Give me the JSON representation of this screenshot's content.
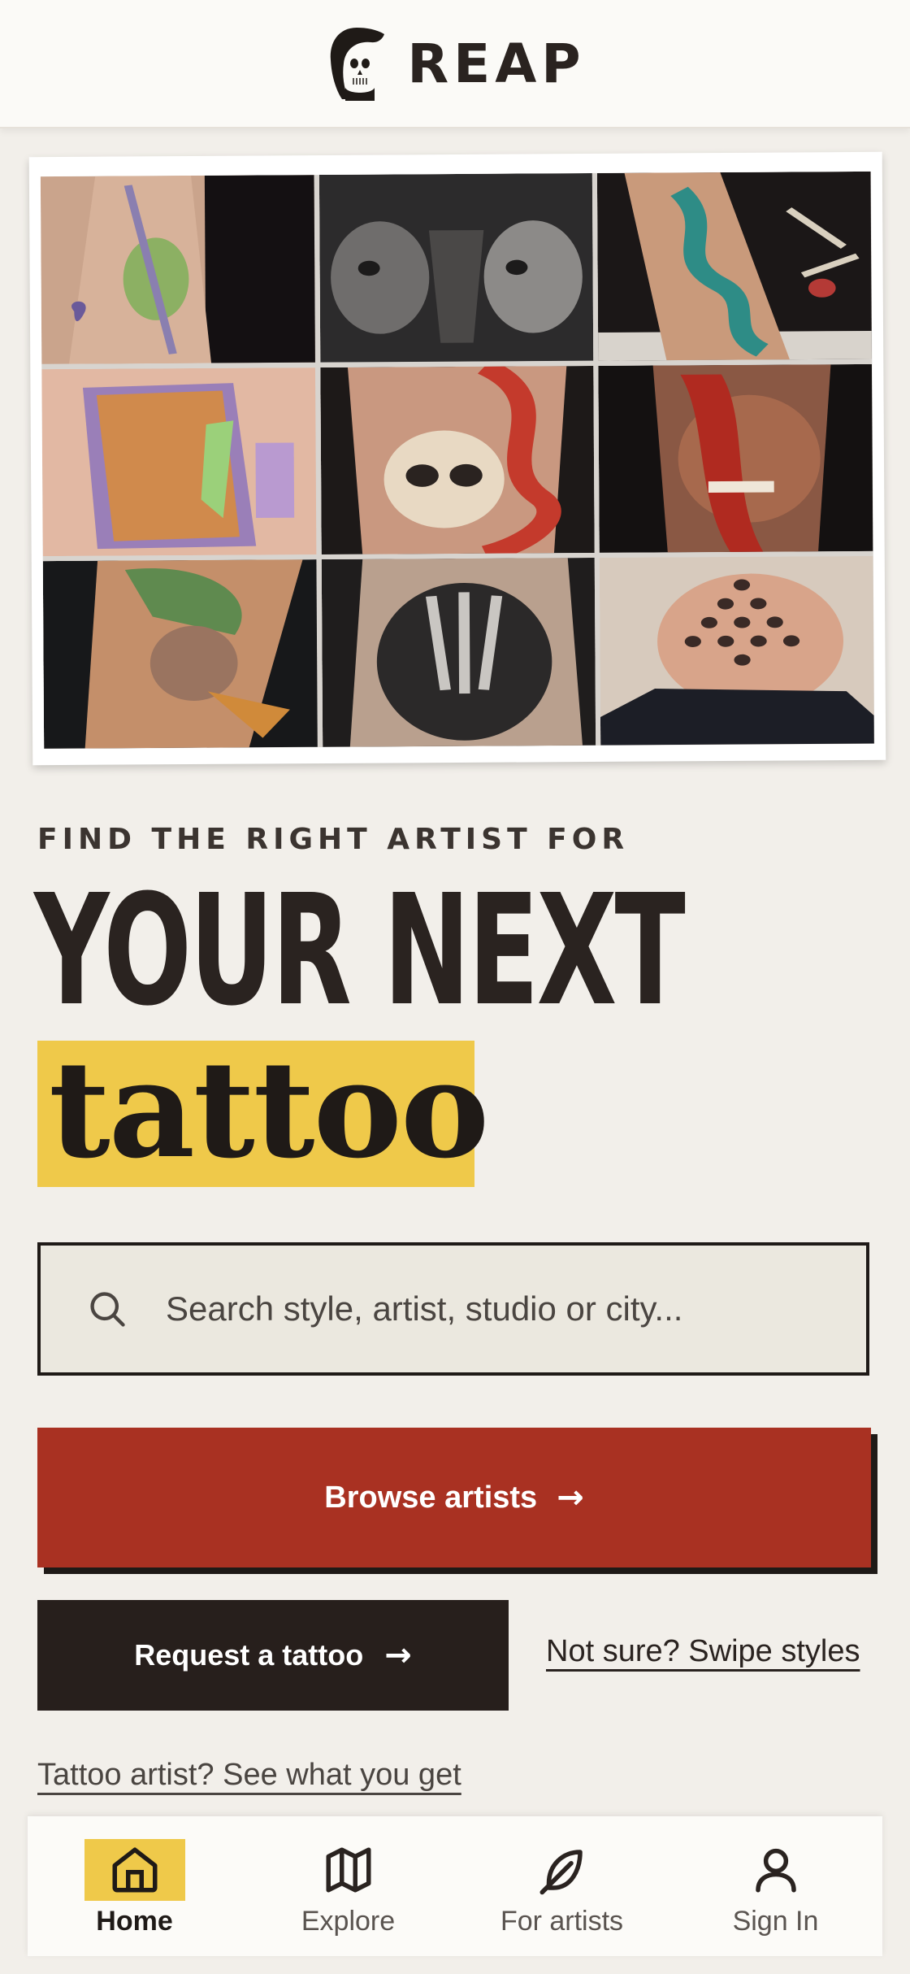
{
  "header": {
    "brand": "REAP",
    "logo_icon": "reaper-skull-icon"
  },
  "hero": {
    "eyebrow": "FIND THE RIGHT ARTIST FOR",
    "headline": "YOUR NEXT",
    "highlight_word": "tattoo",
    "highlight_color": "#efc94a",
    "collage_tiles": [
      "frog-sword-tattoo",
      "egyptian-faces-tattoo",
      "teal-dragon-tattoo",
      "cartoon-character-tattoo",
      "skull-snake-tattoo",
      "devil-face-tattoo",
      "mermaid-portrait-tattoo",
      "dark-knight-tattoo",
      "dotwork-head-tattoo"
    ]
  },
  "search": {
    "placeholder": "Search style, artist, studio or city...",
    "icon": "search-icon"
  },
  "actions": {
    "browse_label": "Browse artists",
    "browse_color": "#a93122",
    "request_label": "Request a tattoo",
    "swipe_label": "Not sure? Swipe styles",
    "artist_link_label": "Tattoo artist? See what you get"
  },
  "tabbar": {
    "items": [
      {
        "label": "Home",
        "icon": "home-icon",
        "active": true
      },
      {
        "label": "Explore",
        "icon": "map-icon",
        "active": false
      },
      {
        "label": "For artists",
        "icon": "feather-icon",
        "active": false
      },
      {
        "label": "Sign In",
        "icon": "user-icon",
        "active": false
      }
    ]
  }
}
